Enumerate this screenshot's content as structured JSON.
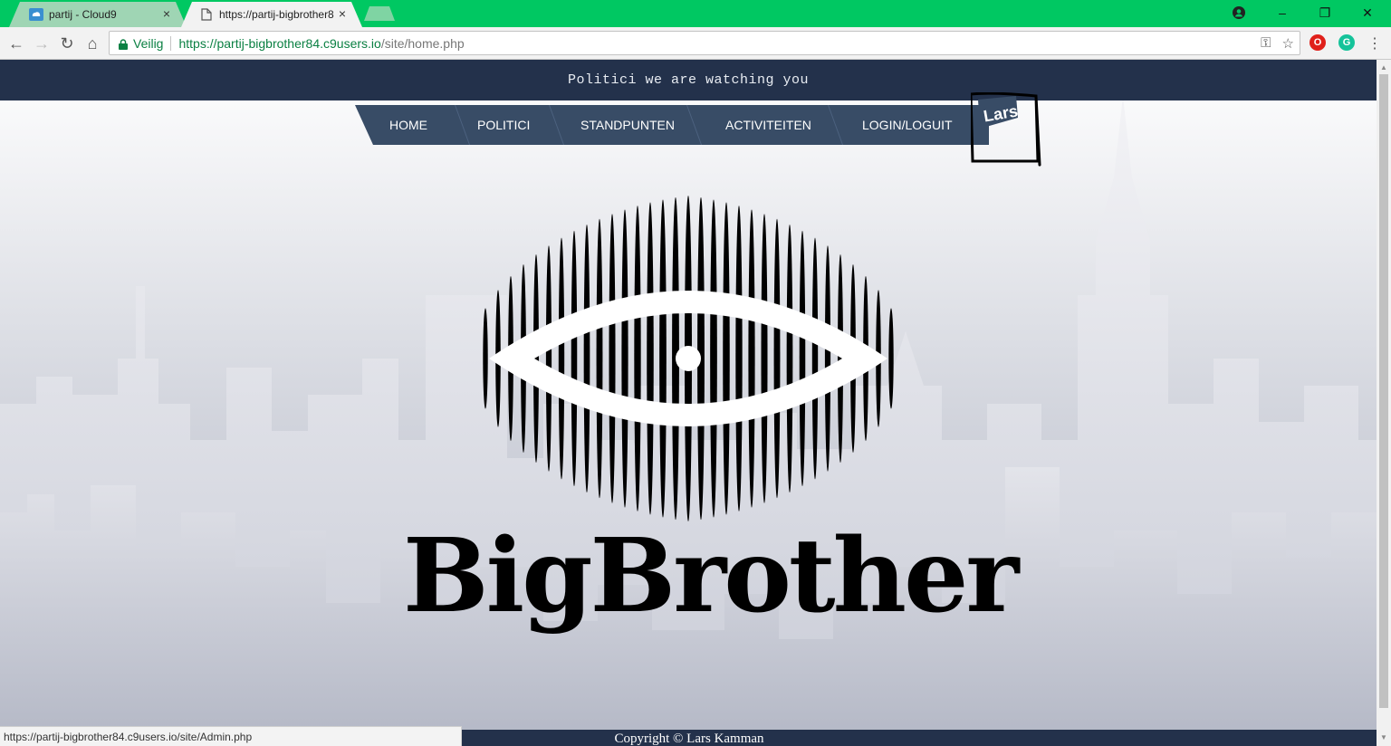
{
  "browser": {
    "tabs": [
      {
        "title": "partij - Cloud9",
        "active": false,
        "icon": "cloud9-icon"
      },
      {
        "title": "https://partij-bigbrother8",
        "active": true,
        "icon": "page-icon"
      }
    ],
    "close_glyph": "×",
    "window_controls": {
      "profile": "●",
      "minimize": "–",
      "restore": "❐",
      "close": "✕"
    },
    "nav": {
      "back": "←",
      "forward": "→",
      "reload": "↻",
      "home": "⌂"
    },
    "address": {
      "secure_label": "Veilig",
      "url_host": "https://partij-bigbrother84.c9users.io",
      "url_path": "/site/home.php"
    },
    "omni_icons": {
      "key": "⚿",
      "star": "☆"
    },
    "extensions": {
      "opera": "O",
      "grammarly": "G"
    },
    "menu": "⋮",
    "status_url": "https://partij-bigbrother84.c9users.io/site/Admin.php",
    "accent": "#00c862"
  },
  "page": {
    "tagline": "Politici we are watching you",
    "nav": [
      {
        "label": "HOME"
      },
      {
        "label": "POLITICI"
      },
      {
        "label": "STANDPUNTEN"
      },
      {
        "label": "ACTIVITEITEN"
      },
      {
        "label": "LOGIN/LOGUIT"
      }
    ],
    "user_badge": "Lars",
    "logo_text": "BigBrother",
    "footer": "Copyright © Lars Kamman",
    "colors": {
      "header_bg": "#23314b",
      "nav_bg": "#384c66"
    }
  }
}
